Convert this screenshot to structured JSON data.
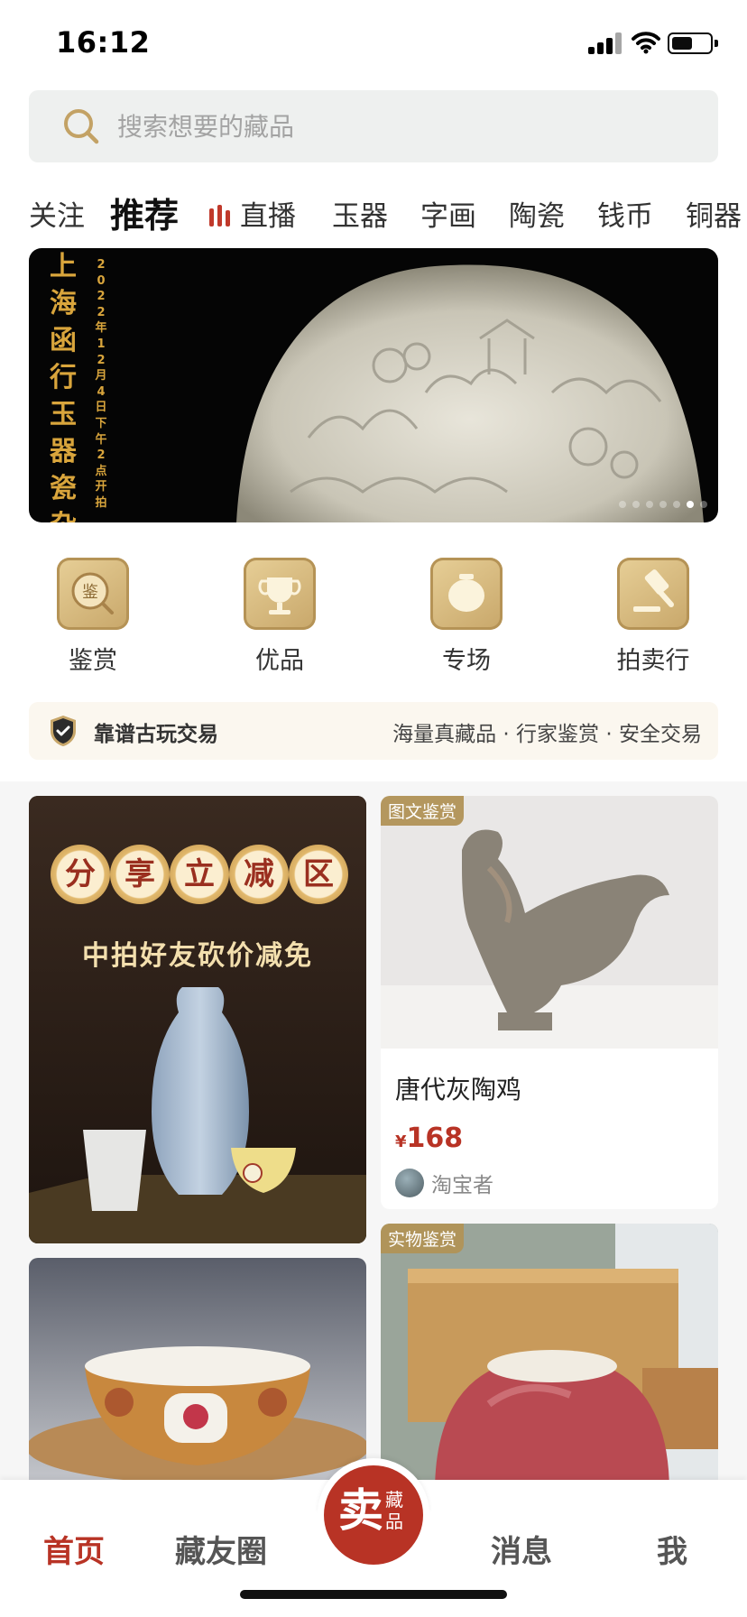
{
  "status_bar": {
    "time": "16:12",
    "battery_level": 0.55
  },
  "search": {
    "placeholder": "搜索想要的藏品"
  },
  "tabs": [
    {
      "label": "关注",
      "active": false
    },
    {
      "label": "推荐",
      "active": true
    },
    {
      "label": "直播",
      "active": false,
      "icon": "live-bars-icon"
    },
    {
      "label": "玉器",
      "active": false
    },
    {
      "label": "字画",
      "active": false
    },
    {
      "label": "陶瓷",
      "active": false
    },
    {
      "label": "钱币",
      "active": false
    },
    {
      "label": "铜器",
      "active": false
    }
  ],
  "banner": {
    "title": "上海函行玉器瓷杂",
    "date": "2022年12月4日下午2点开拍",
    "dots_count": 7,
    "active_dot": 5
  },
  "quick_actions": [
    {
      "label": "鉴赏",
      "icon": "appraise-icon"
    },
    {
      "label": "优品",
      "icon": "trophy-icon"
    },
    {
      "label": "专场",
      "icon": "jar-icon"
    },
    {
      "label": "拍卖行",
      "icon": "gavel-icon"
    }
  ],
  "trust": {
    "title": "靠谱古玩交易",
    "slogan": "海量真藏品 · 行家鉴赏 · 安全交易"
  },
  "promo": {
    "circles": [
      "分",
      "享",
      "立",
      "减",
      "区"
    ],
    "subtitle": "中拍好友砍价减免"
  },
  "cards": [
    {
      "tag": "图文鉴赏",
      "title": "唐代灰陶鸡",
      "currency": "¥",
      "price": "168",
      "seller": "淘宝者"
    },
    {
      "tag": "实物鉴赏"
    }
  ],
  "tabbar": {
    "home": "首页",
    "circle": "藏友圈",
    "sell_big": "卖",
    "sell_small": "藏品",
    "messages": "消息",
    "me": "我"
  },
  "colors": {
    "accent": "#b83325",
    "gold": "#c8a76a",
    "banner_text": "#d9a53c"
  }
}
